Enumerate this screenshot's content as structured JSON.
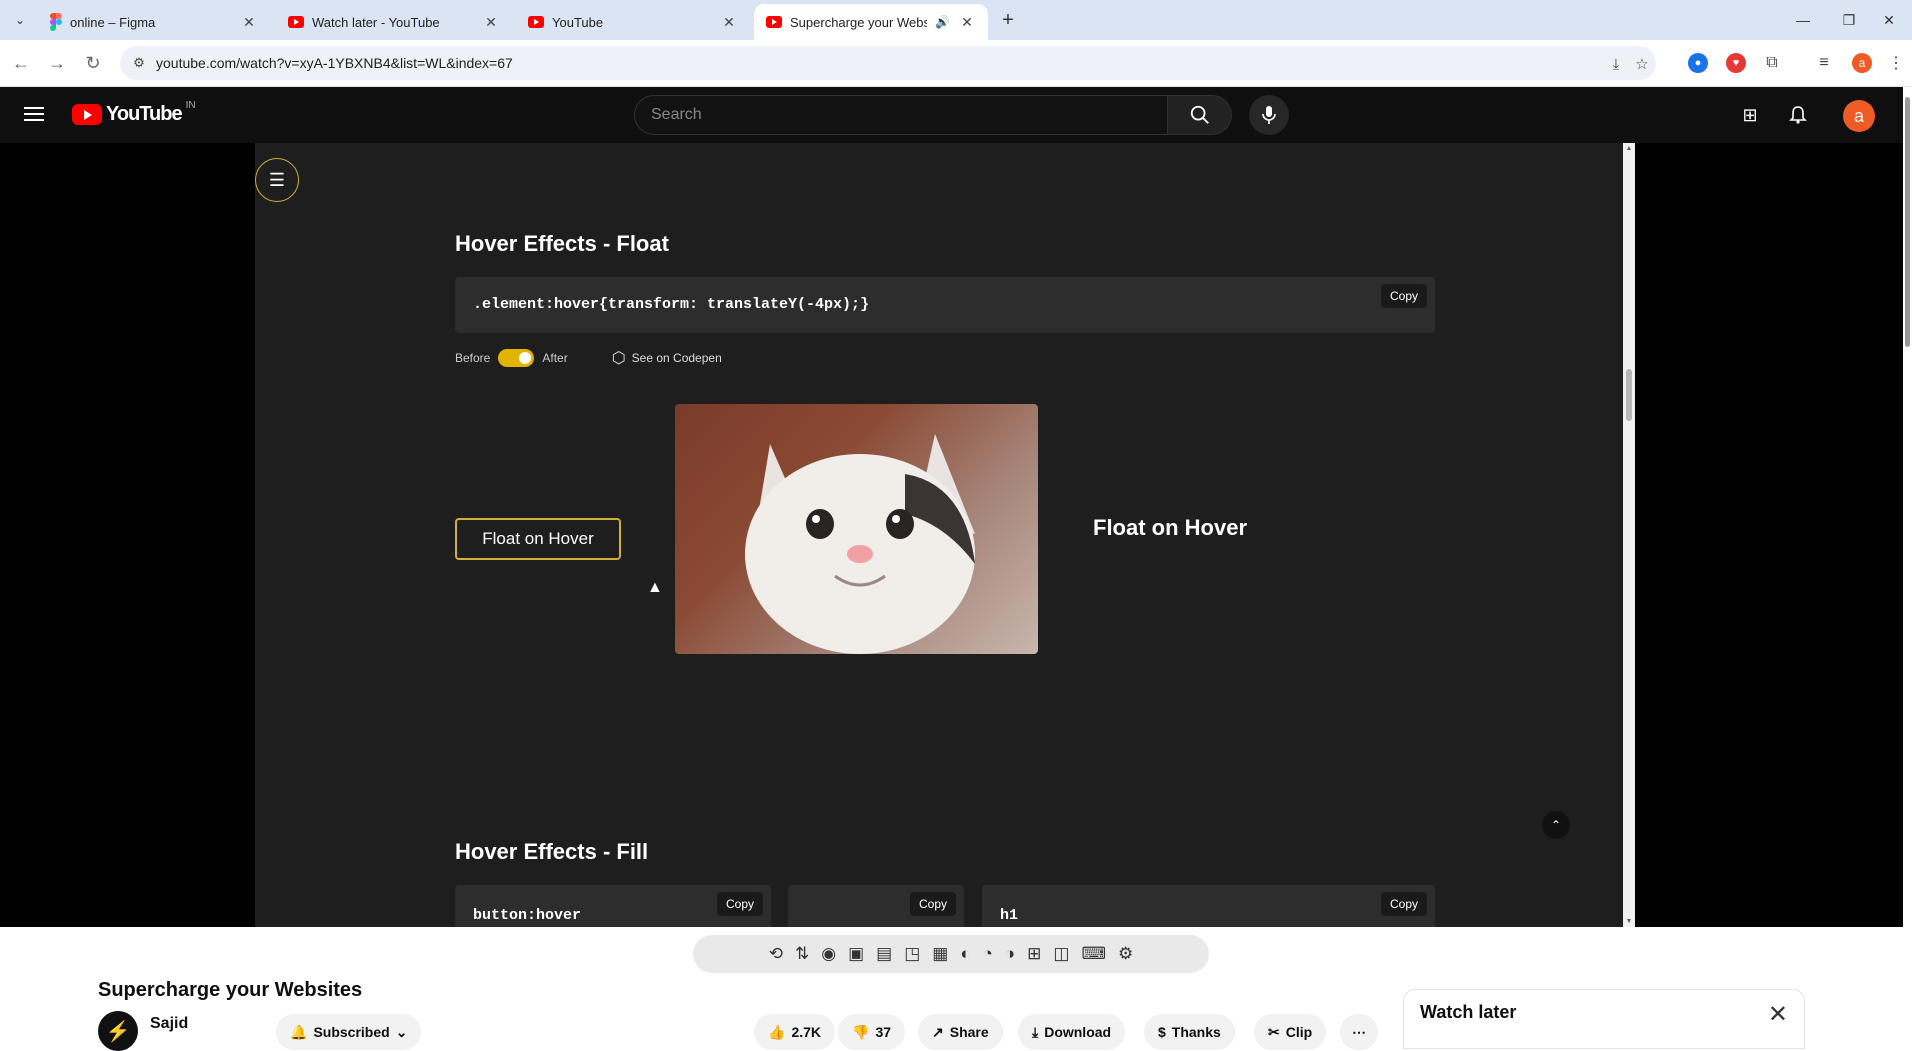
{
  "browser": {
    "tabs": [
      {
        "title": "online – Figma",
        "icon": "figma-icon"
      },
      {
        "title": "Watch later - YouTube",
        "icon": "youtube-icon"
      },
      {
        "title": "YouTube",
        "icon": "youtube-icon"
      },
      {
        "title": "Supercharge your Websites",
        "icon": "youtube-icon",
        "active": true
      }
    ],
    "url": "youtube.com/watch?v=xyA-1YBXNB4&list=WL&index=67",
    "profile_initial": "a"
  },
  "masthead": {
    "logo_text": "YouTube",
    "country_code": "IN",
    "search_placeholder": "Search",
    "avatar_initial": "a"
  },
  "video": {
    "float_section": {
      "title": "Hover Effects - Float",
      "code": ".element:hover{transform: translateY(-4px);}",
      "copy_label": "Copy",
      "before_label": "Before",
      "after_label": "After",
      "codepen_label": "See on Codepen",
      "button_label": "Float on Hover",
      "image_caption": "Float on Hover"
    },
    "fill_section": {
      "title": "Hover Effects - Fill",
      "code_blocks": [
        {
          "code": "button:hover",
          "copy_label": "Copy"
        },
        {
          "code": "",
          "copy_label": "Copy"
        },
        {
          "code": "h1",
          "copy_label": "Copy"
        }
      ]
    }
  },
  "details": {
    "title": "Supercharge your Websites",
    "channel": "Sajid",
    "subscribe_label": "Subscribed",
    "likes": "2.7K",
    "dislikes": "37",
    "share_label": "Share",
    "download_label": "Download",
    "thanks_label": "Thanks",
    "clip_label": "Clip"
  },
  "playlist_panel": {
    "title": "Watch later"
  },
  "colors": {
    "accent_gold": "#d4af37",
    "toggle_on": "#e2b400",
    "youtube_red": "#ff0000",
    "avatar": "#ef5b25"
  }
}
